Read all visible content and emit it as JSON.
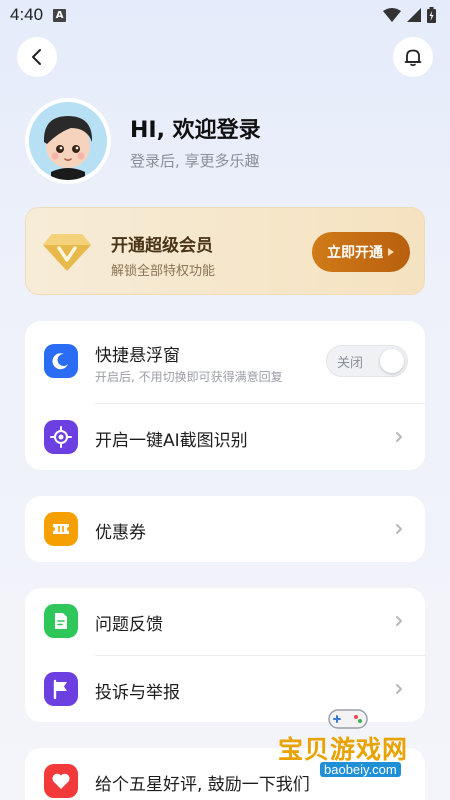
{
  "status_bar": {
    "time": "4:40",
    "a_badge": "A"
  },
  "profile": {
    "greeting": "HI, 欢迎登录",
    "subtitle": "登录后, 享更多乐趣"
  },
  "vip": {
    "title": "开通超级会员",
    "subtitle": "解锁全部特权功能",
    "button_label": "立即开通"
  },
  "menu": {
    "floating_window": {
      "label": "快捷悬浮窗",
      "sub": "开启后, 不用切换即可获得满意回复",
      "toggle_label": "关闭",
      "icon_color": "#2a6df4"
    },
    "ai_screenshot": {
      "label": "开启一键AI截图识别",
      "icon_color": "#6b3fe0"
    },
    "coupons": {
      "label": "优惠券",
      "icon_color": "#f5a000"
    },
    "feedback": {
      "label": "问题反馈",
      "icon_color": "#2fc75a"
    },
    "report": {
      "label": "投诉与举报",
      "icon_color": "#6b3fe0"
    },
    "rating": {
      "label": "给个五星好评, 鼓励一下我们",
      "icon_color": "#f23a3a"
    }
  },
  "watermark": {
    "text": "宝贝游戏网",
    "url": "baobeiy.com"
  }
}
